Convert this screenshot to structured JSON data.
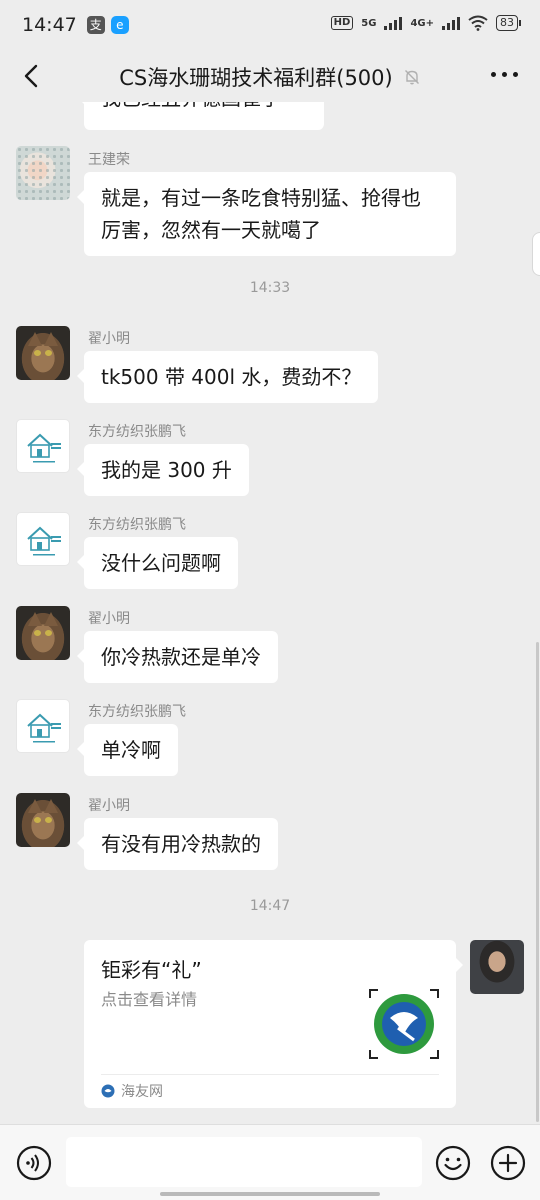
{
  "status_bar": {
    "time": "14:47",
    "app_icon_1": "支",
    "app_icon_2": "e",
    "hd_label": "HD",
    "net1": "5G",
    "net2": "4G+",
    "battery": "83"
  },
  "header": {
    "title": "CS海水珊瑚技术福利群(500)",
    "mute_icon": "bell-off-icon",
    "back_icon": "chevron-left-icon",
    "more_icon": "more-dots-icon"
  },
  "messages": [
    {
      "id": "m0",
      "text": "我已经丑养德国崔子"
    },
    {
      "id": "m1",
      "sender": "王建荣",
      "text": "就是，有过一条吃食特别猛、抢得也厉害，忽然有一天就噶了"
    },
    {
      "id": "t1",
      "time": "14:33"
    },
    {
      "id": "m2",
      "sender": "翟小明",
      "text": "tk500 带 400l 水，费劲不？"
    },
    {
      "id": "m3",
      "sender": "东方纺织张鹏飞",
      "text": "我的是 300 升"
    },
    {
      "id": "m4",
      "sender": "东方纺织张鹏飞",
      "text": "没什么问题啊"
    },
    {
      "id": "m5",
      "sender": "翟小明",
      "text": "你冷热款还是单冷"
    },
    {
      "id": "m6",
      "sender": "东方纺织张鹏飞",
      "text": "单冷啊"
    },
    {
      "id": "m7",
      "sender": "翟小明",
      "text": "有没有用冷热款的"
    },
    {
      "id": "t2",
      "time": "14:47"
    }
  ],
  "link_card": {
    "title": "钜彩有“礼”",
    "description": "点击查看详情",
    "source": "海友网"
  },
  "input_bar": {
    "placeholder": "",
    "voice_icon": "voice-icon",
    "emoji_icon": "emoji-icon",
    "plus_icon": "plus-icon"
  },
  "colors": {
    "background": "#ededed",
    "bubble": "#ffffff",
    "sender_name": "#8a8a8a",
    "text": "#191919"
  }
}
